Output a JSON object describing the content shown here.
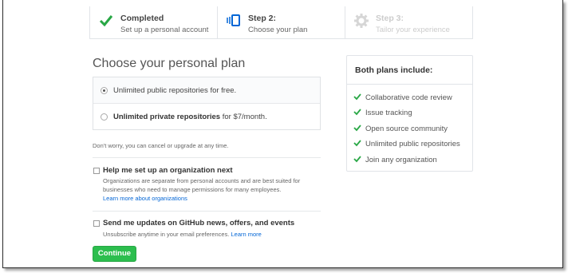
{
  "steps": [
    {
      "title": "Completed",
      "subtitle": "Set up a personal account",
      "icon": "check-icon"
    },
    {
      "title": "Step 2:",
      "subtitle": "Choose your plan",
      "icon": "plan-icon"
    },
    {
      "title": "Step 3:",
      "subtitle": "Tailor your experience",
      "icon": "gear-icon"
    }
  ],
  "plan": {
    "heading": "Choose your personal plan",
    "options": [
      {
        "text": "Unlimited public repositories for free.",
        "checked": true
      },
      {
        "bold": "Unlimited private repositories",
        "rest": " for $7/month.",
        "checked": false
      }
    ],
    "note": "Don't worry, you can cancel or upgrade at any time."
  },
  "org": {
    "label": "Help me set up an organization next",
    "help": "Organizations are separate from personal accounts and are best suited for businesses who need to manage permissions for many employees.",
    "link": "Learn more about organizations"
  },
  "updates": {
    "label": "Send me updates on GitHub news, offers, and events",
    "help": "Unsubscribe anytime in your email preferences.",
    "link": "Learn more"
  },
  "continue_label": "Continue",
  "includes": {
    "title": "Both plans include:",
    "items": [
      "Collaborative code review",
      "Issue tracking",
      "Open source community",
      "Unlimited public repositories",
      "Join any organization"
    ]
  },
  "colors": {
    "accent_green": "#2cbe4e",
    "link_blue": "#0366d6",
    "check_green": "#28a745"
  }
}
